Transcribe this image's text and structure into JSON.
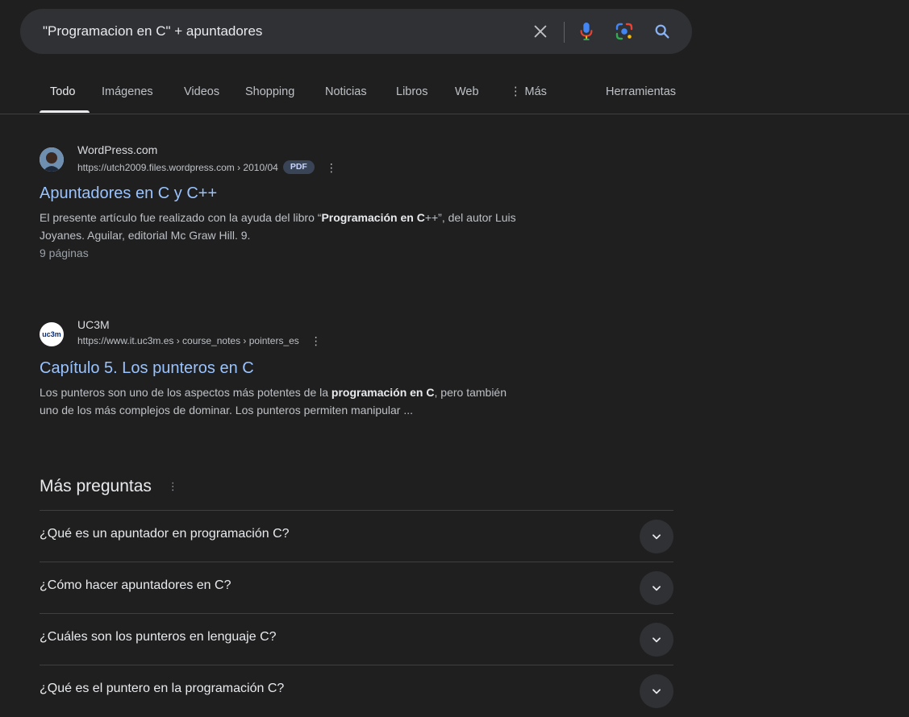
{
  "search": {
    "query": "\"Programacion en C\" + apuntadores"
  },
  "tabs": [
    {
      "label": "Todo"
    },
    {
      "label": "Imágenes"
    },
    {
      "label": "Videos"
    },
    {
      "label": "Shopping"
    },
    {
      "label": "Noticias"
    },
    {
      "label": "Libros"
    },
    {
      "label": "Web"
    },
    {
      "label": "⋮ Más"
    },
    {
      "label": "Herramientas"
    }
  ],
  "results": [
    {
      "site_name": "WordPress.com",
      "url": "https://utch2009.files.wordpress.com › 2010/04",
      "badge": "PDF",
      "title": "Apuntadores en C y C++",
      "snippet_1": "El presente artículo fue realizado con la ayuda del libro “",
      "snippet_bold": "Programación en C",
      "snippet_2": "++”, del autor Luis",
      "snippet_line2": "Joyanes. Aguilar, editorial Mc Graw Hill. 9.",
      "meta": "9 páginas"
    },
    {
      "site_name": "UC3M",
      "favicon_text": "uc3m",
      "url": "https://www.it.uc3m.es › course_notes › pointers_es",
      "title": "Capítulo 5. Los punteros en C",
      "snippet_1": "Los punteros son uno de los aspectos más potentes de la ",
      "snippet_bold": "programación en C",
      "snippet_2": ", pero también",
      "snippet_line2": "uno de los más complejos de dominar. Los punteros permiten manipular ..."
    }
  ],
  "paa": {
    "heading": "Más preguntas",
    "questions": [
      "¿Qué es un apuntador en programación C?",
      "¿Cómo hacer apuntadores en C?",
      "¿Cuáles son los punteros en lenguaje C?",
      "¿Qué es el puntero en la programación C?"
    ]
  },
  "colors": {
    "background": "#1f1f1f",
    "link": "#99c3ff",
    "search_bar": "#303134"
  }
}
